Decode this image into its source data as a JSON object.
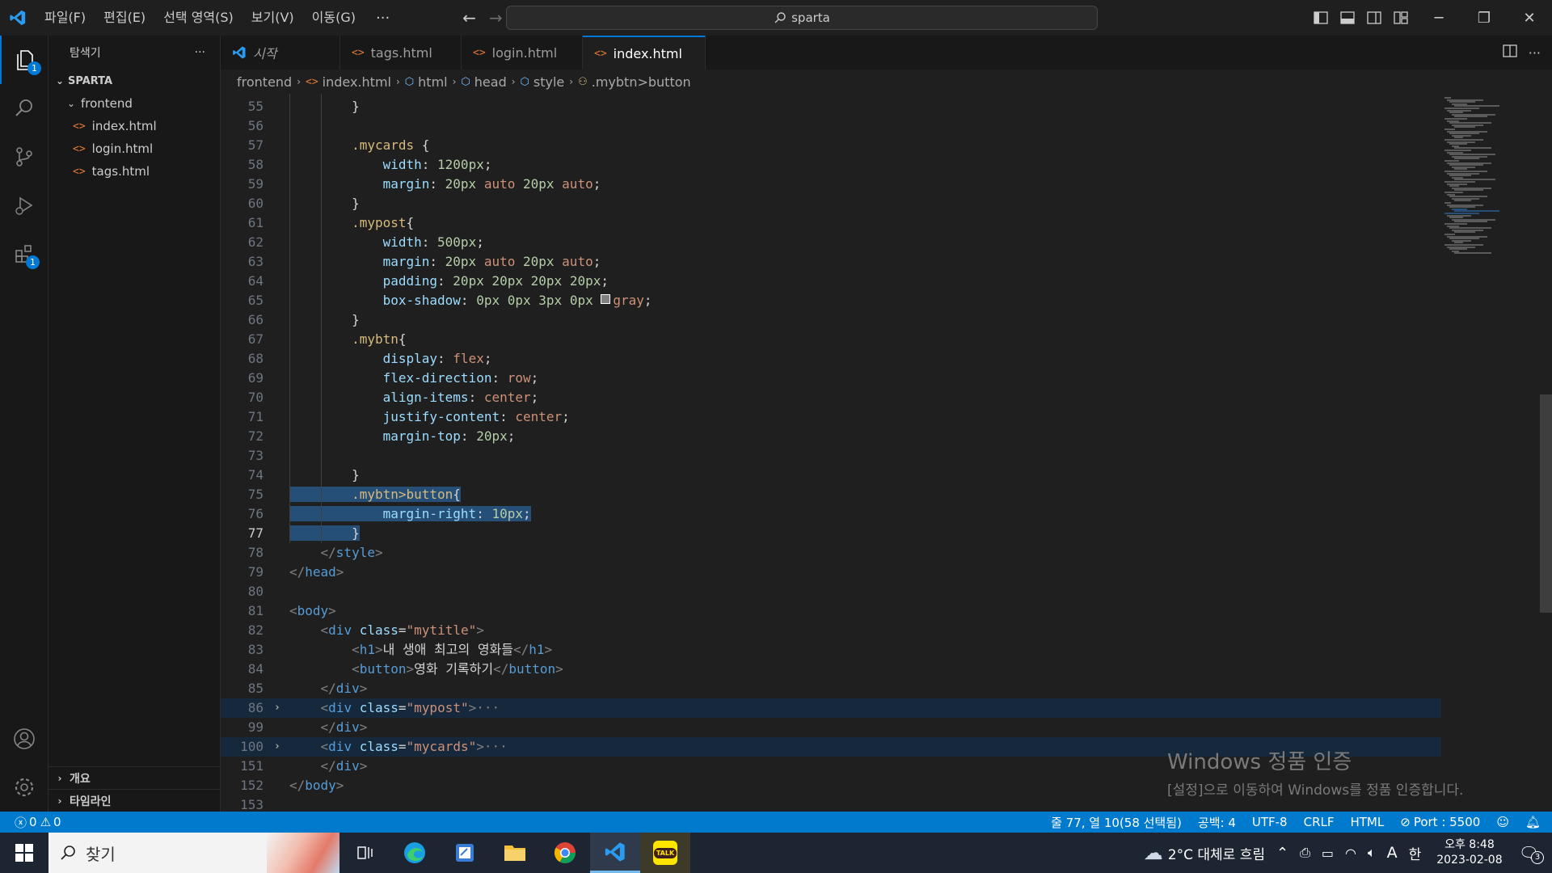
{
  "titlebar": {
    "menus": [
      "파일(F)",
      "편집(E)",
      "선택 영역(S)",
      "보기(V)",
      "이동(G)"
    ],
    "more": "···",
    "search_text": "sparta"
  },
  "activity": {
    "explorer_badge": "1",
    "extensions_badge": "1"
  },
  "sidebar": {
    "title": "탐색기",
    "more": "···",
    "root": "SPARTA",
    "folder": "frontend",
    "files": [
      "index.html",
      "login.html",
      "tags.html"
    ],
    "bottom": [
      "개요",
      "타임라인"
    ]
  },
  "tabs": [
    {
      "label": "시작"
    },
    {
      "label": "tags.html"
    },
    {
      "label": "login.html"
    },
    {
      "label": "index.html"
    }
  ],
  "breadcrumb": [
    "frontend",
    "index.html",
    "html",
    "head",
    "style",
    ".mybtn>button"
  ],
  "editor": {
    "lines": [
      {
        "n": "55",
        "t": "        }"
      },
      {
        "n": "56",
        "t": ""
      },
      {
        "n": "57",
        "t": "        .mycards {"
      },
      {
        "n": "58",
        "t": "            width: 1200px;"
      },
      {
        "n": "59",
        "t": "            margin: 20px auto 20px auto;"
      },
      {
        "n": "60",
        "t": "        }"
      },
      {
        "n": "61",
        "t": "        .mypost{"
      },
      {
        "n": "62",
        "t": "            width: 500px;"
      },
      {
        "n": "63",
        "t": "            margin: 20px auto 20px auto;"
      },
      {
        "n": "64",
        "t": "            padding: 20px 20px 20px 20px;"
      },
      {
        "n": "65",
        "t": "            box-shadow: 0px 0px 3px 0px gray;"
      },
      {
        "n": "66",
        "t": "        }"
      },
      {
        "n": "67",
        "t": "        .mybtn{"
      },
      {
        "n": "68",
        "t": "            display: flex;"
      },
      {
        "n": "69",
        "t": "            flex-direction: row;"
      },
      {
        "n": "70",
        "t": "            align-items: center;"
      },
      {
        "n": "71",
        "t": "            justify-content: center;"
      },
      {
        "n": "72",
        "t": "            margin-top: 20px;"
      },
      {
        "n": "73",
        "t": ""
      },
      {
        "n": "74",
        "t": "        }"
      },
      {
        "n": "75",
        "t": "        .mybtn>button{"
      },
      {
        "n": "76",
        "t": "            margin-right: 10px;"
      },
      {
        "n": "77",
        "t": "        }"
      },
      {
        "n": "78",
        "t": "    </style>"
      },
      {
        "n": "79",
        "t": "</head>"
      },
      {
        "n": "80",
        "t": ""
      },
      {
        "n": "81",
        "t": "<body>"
      },
      {
        "n": "82",
        "t": "    <div class=\"mytitle\">"
      },
      {
        "n": "83",
        "t": "        <h1>내 생애 최고의 영화들</h1>"
      },
      {
        "n": "84",
        "t": "        <button>영화 기록하기</button>"
      },
      {
        "n": "85",
        "t": "    </div>"
      },
      {
        "n": "86",
        "t": "    <div class=\"mypost\">···"
      },
      {
        "n": "99",
        "t": "    </div>"
      },
      {
        "n": "100",
        "t": "    <div class=\"mycards\">···"
      },
      {
        "n": "151",
        "t": "    </div>"
      },
      {
        "n": "152",
        "t": "</body>"
      },
      {
        "n": "153",
        "t": ""
      }
    ]
  },
  "watermark": {
    "title": "Windows 정품 인증",
    "subtitle": "[설정]으로 이동하여 Windows를 정품 인증합니다."
  },
  "statusbar": {
    "errors": "0",
    "warnings": "0",
    "position": "줄 77, 열 10(58 선택됨)",
    "spaces": "공백: 4",
    "encoding": "UTF-8",
    "eol": "CRLF",
    "language": "HTML",
    "port": "Port : 5500"
  },
  "taskbar": {
    "search_placeholder": "찾기",
    "weather": "2°C 대체로 흐림",
    "ime_mode": "A",
    "ime_lang": "한",
    "time": "오후 8:48",
    "date": "2023-02-08",
    "notifications": "3",
    "talk_label": "TALK"
  },
  "colors": {
    "accent": "#007acc",
    "selection": "#264f78",
    "editor_bg": "#1f1f1f"
  }
}
